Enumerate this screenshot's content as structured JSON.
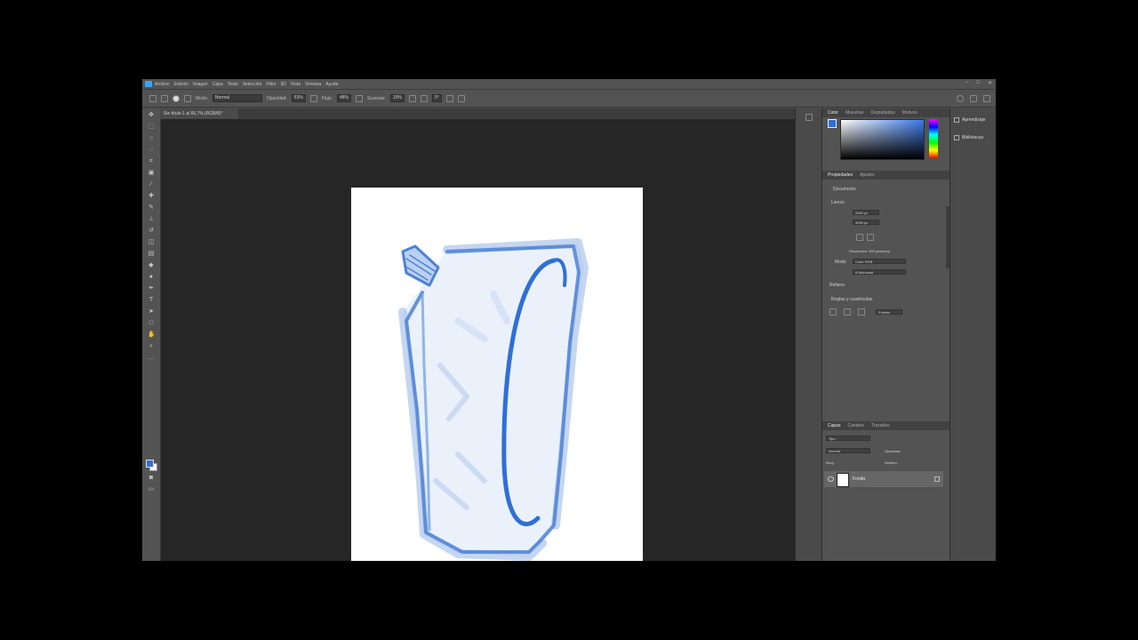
{
  "menu": {
    "items": [
      "Archivo",
      "Edición",
      "Imagen",
      "Capa",
      "Texto",
      "Selección",
      "Filtro",
      "3D",
      "Vista",
      "Ventana",
      "Ayuda"
    ]
  },
  "options_bar": {
    "mode_label": "Modo:",
    "mode_value": "Normal",
    "opacity_label": "Opacidad:",
    "opacity_value": "53%",
    "flow_label": "Flujo:",
    "flow_value": "48%",
    "smoothing_label": "Suavizar:",
    "smoothing_value": "10%",
    "angle_value": "0°"
  },
  "document": {
    "tab_title": "Sin título-1 al 66,7% (RGB/8)*"
  },
  "color_panel": {
    "tabs": [
      "Color",
      "Muestras",
      "Degradados",
      "Motivos"
    ],
    "foreground_color": "#2f6fd8"
  },
  "properties_panel": {
    "tabs": [
      "Propiedades",
      "Ajustes"
    ],
    "doc_label": "Documento",
    "canvas_section": "Lienzo",
    "width_value": "2000 px",
    "height_value": "3000 px",
    "resolution_text": "Resolución: 300 píxeles/p",
    "mode_label": "Modo",
    "mode_value": "Color RGB",
    "depth_value": "8 bits/canal",
    "fill_label": "Relleno",
    "guides_section": "Reglas y cuadrículas",
    "units_value": "Píxeles"
  },
  "layers_panel": {
    "tabs": [
      "Capas",
      "Canales",
      "Trazados"
    ],
    "kind_label": "Tipo",
    "blend_value": "Normal",
    "opacity_label": "Opacidad:",
    "lock_label": "Bloq.:",
    "fill_label": "Relleno:",
    "layer_name": "Fondo"
  },
  "right_column": {
    "items": [
      "Aprendizaje",
      "Bibliotecas"
    ]
  },
  "colors": {
    "app_bg": "#535353",
    "canvas_bg": "#262626",
    "stroke_blue": "#2f6fd8"
  }
}
